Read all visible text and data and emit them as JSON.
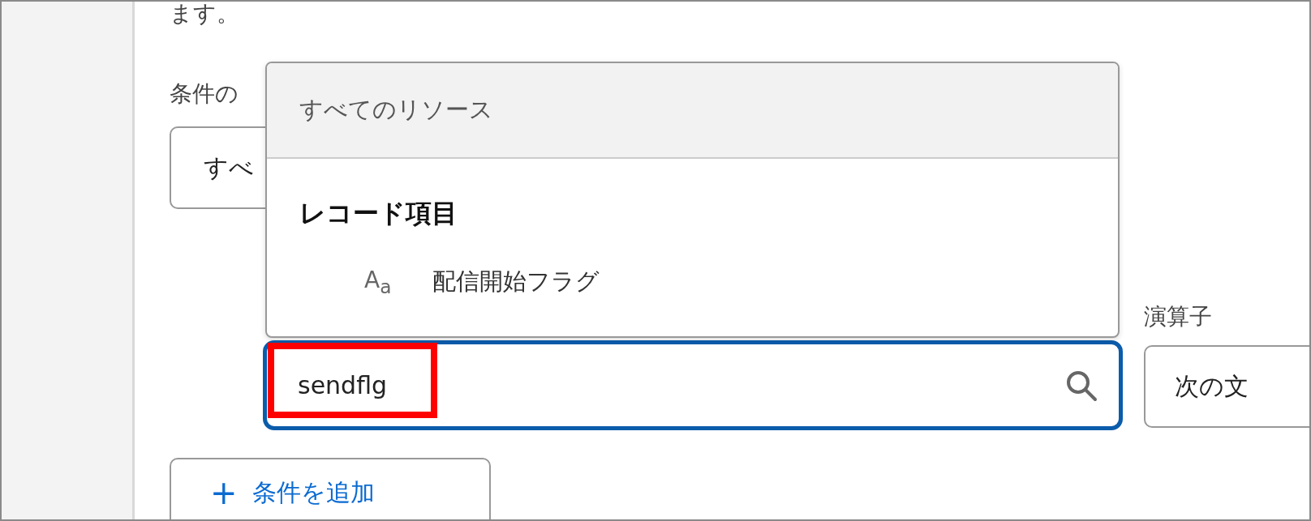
{
  "intro_text": "ます。",
  "condition_label": "条件の",
  "condition_select": {
    "value": "すべ"
  },
  "resource_dropdown": {
    "header": "すべてのリソース",
    "groups": [
      {
        "title": "レコード項目",
        "items": [
          {
            "type_icon": "A$_{a}$",
            "label": "配信開始フラグ"
          }
        ]
      }
    ]
  },
  "search_field": {
    "value": "sendflg",
    "focused": true,
    "highlighted": true
  },
  "operator": {
    "label": "演算子",
    "value": "次の文"
  },
  "add_condition_button": {
    "icon": "+",
    "label": "条件を追加"
  }
}
